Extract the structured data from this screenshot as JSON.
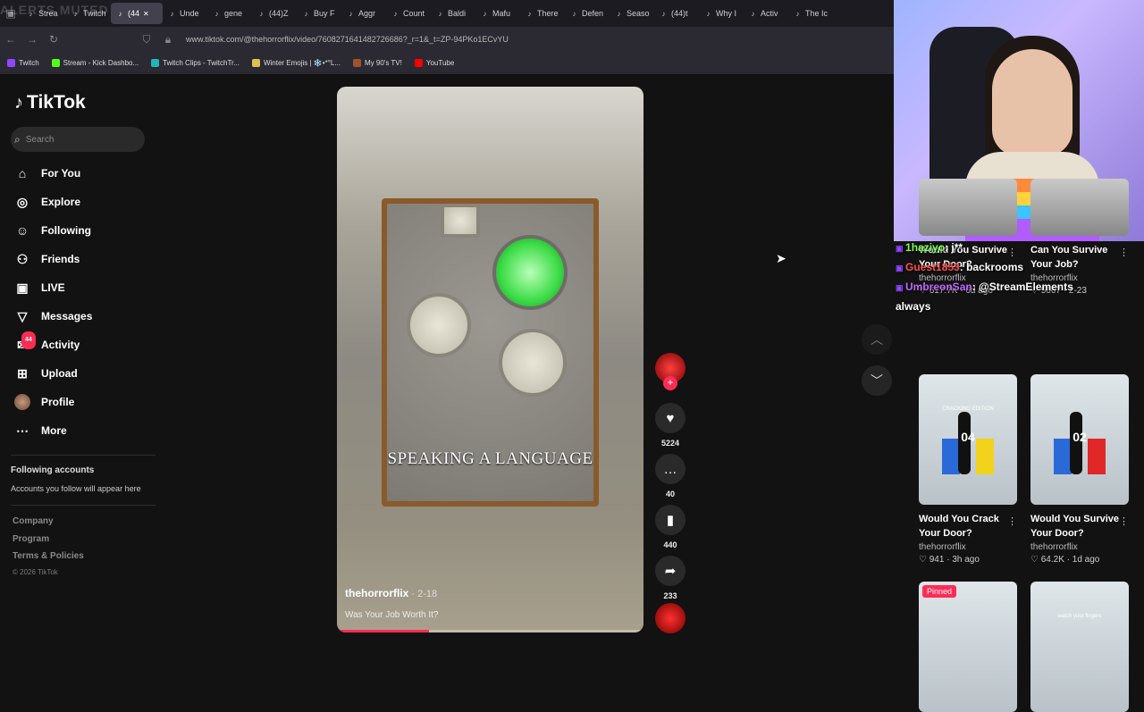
{
  "browser": {
    "watermark": "ALERTS MUTED",
    "tabs": [
      "Strea",
      "Twitch",
      "(44",
      "Unde",
      "gene",
      "(44)Z",
      "Buy F",
      "Aggr",
      "Count",
      "Baldi",
      "Mafu",
      "There",
      "Defen",
      "Seaso",
      "(44)t",
      "Why I",
      "Activ",
      "The Ic"
    ],
    "active_tab_index": 2,
    "url": "www.tiktok.com/@thehorrorflix/video/7608271641482726686?_r=1&_t=ZP-94PKo1ECvYU",
    "bookmarks": [
      {
        "label": "Twitch",
        "color": "#9146ff"
      },
      {
        "label": "Stream - Kick Dashbo...",
        "color": "#53fc18"
      },
      {
        "label": "Twitch Clips - TwitchTr...",
        "color": "#1fb7b7"
      },
      {
        "label": "Winter Emojis | ❄️•*°L...",
        "color": "#e0c050"
      },
      {
        "label": "My 90's TV!",
        "color": "#a0522d"
      },
      {
        "label": "YouTube",
        "color": "#ff0000"
      }
    ]
  },
  "tiktok": {
    "logo": "TikTok",
    "search_placeholder": "Search",
    "nav": [
      {
        "label": "For You",
        "icon": "home-icon",
        "glyph": "⌂"
      },
      {
        "label": "Explore",
        "icon": "compass-icon",
        "glyph": "◎"
      },
      {
        "label": "Following",
        "icon": "following-icon",
        "glyph": "☺"
      },
      {
        "label": "Friends",
        "icon": "friends-icon",
        "glyph": "⚇"
      },
      {
        "label": "LIVE",
        "icon": "live-icon",
        "glyph": "▣"
      },
      {
        "label": "Messages",
        "icon": "messages-icon",
        "glyph": "▽"
      },
      {
        "label": "Activity",
        "icon": "activity-icon",
        "glyph": "✉",
        "badge": "44"
      },
      {
        "label": "Upload",
        "icon": "upload-icon",
        "glyph": "⊞"
      },
      {
        "label": "Profile",
        "icon": "profile-avatar-icon",
        "glyph": ""
      },
      {
        "label": "More",
        "icon": "more-icon",
        "glyph": "⋯"
      }
    ],
    "following_heading": "Following accounts",
    "following_note": "Accounts you follow will appear here",
    "footer_links": [
      "Company",
      "Program",
      "Terms & Policies"
    ],
    "copyright": "© 2026 TikTok"
  },
  "video": {
    "caption_overlay": "SPEAKING A LANGUAGE",
    "author": "thehorrorflix",
    "date": " · 2-18",
    "description": "Was Your Job Worth It?",
    "progress": 0.3,
    "likes": "5224",
    "comments": "40",
    "saves": "440",
    "shares": "233"
  },
  "chat": [
    {
      "user": "1haziyo",
      "message": "j**",
      "user_color": "#7cff4c"
    },
    {
      "user": "Guest1853",
      "message": "backrooms",
      "user_color": "#ff5050"
    },
    {
      "user": "UmbreonSan",
      "message": "@StreamElements",
      "user_color": "#c266ff"
    },
    {
      "user": "",
      "message": "always",
      "user_color": "#ffffff"
    }
  ],
  "cards": [
    {
      "title": "Would You Survive Your Door?",
      "author": "thehorrorflix",
      "stats": "♡ 617.7K · 6d ago",
      "pinned": ""
    },
    {
      "title": "Can You Survive Your Job?",
      "author": "thehorrorflix",
      "stats": "♡ 5667 · 2-23",
      "pinned": ""
    },
    {
      "title": "Would You Crack Your Door?",
      "author": "thehorrorflix",
      "stats": "♡ 941 · 3h ago",
      "pinned": "",
      "thumb_label": "CRACKING EDITION",
      "number": "04"
    },
    {
      "title": "Would You Survive Your Door?",
      "author": "thehorrorflix",
      "stats": "♡ 64.2K · 1d ago",
      "pinned": "",
      "number": "02"
    },
    {
      "title": "",
      "author": "",
      "stats": "",
      "pinned": "Pinned"
    },
    {
      "title": "",
      "author": "",
      "stats": "",
      "pinned": "",
      "thumb_label": "watch your fingers"
    }
  ]
}
